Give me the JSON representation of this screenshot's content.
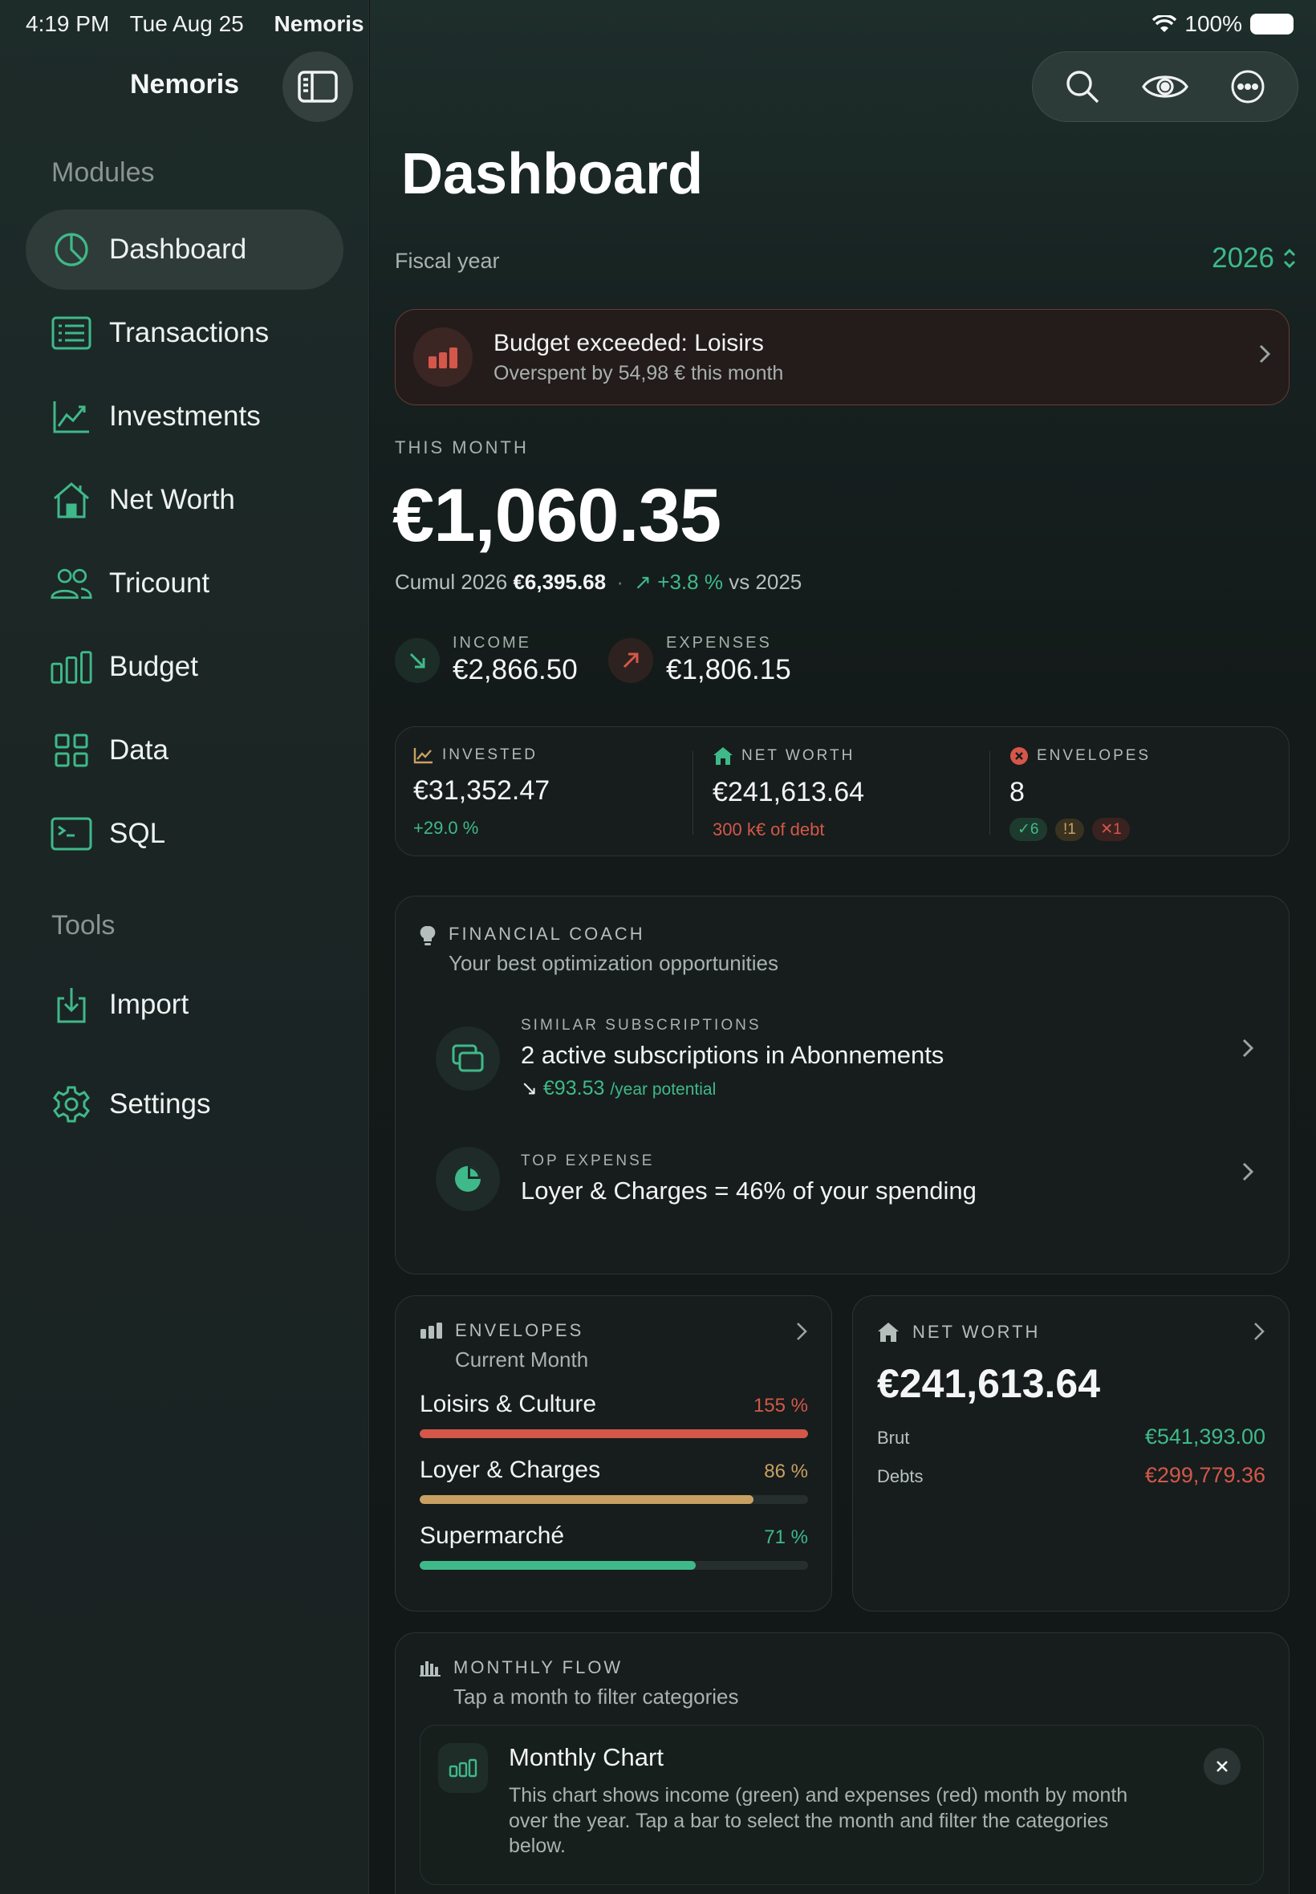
{
  "status_bar": {
    "time": "4:19 PM",
    "date": "Tue Aug 25",
    "app": "Nemoris",
    "battery": "100%"
  },
  "sidebar": {
    "title": "Nemoris",
    "modules_label": "Modules",
    "tools_label": "Tools",
    "items": [
      {
        "label": "Dashboard",
        "icon": "pie-chart-icon",
        "active": true
      },
      {
        "label": "Transactions",
        "icon": "list-icon"
      },
      {
        "label": "Investments",
        "icon": "trend-chart-icon"
      },
      {
        "label": "Net Worth",
        "icon": "house-icon"
      },
      {
        "label": "Tricount",
        "icon": "people-icon"
      },
      {
        "label": "Budget",
        "icon": "bar-chart-icon"
      },
      {
        "label": "Data",
        "icon": "grid-icon"
      },
      {
        "label": "SQL",
        "icon": "terminal-icon"
      }
    ],
    "tools": [
      {
        "label": "Import",
        "icon": "import-icon"
      },
      {
        "label": "Settings",
        "icon": "gear-icon"
      }
    ]
  },
  "main": {
    "title": "Dashboard",
    "fiscal_year_label": "Fiscal year",
    "fiscal_year_value": "2026",
    "alert": {
      "title": "Budget exceeded: Loisirs",
      "subtitle": "Overspent by 54,98 € this month"
    },
    "this_month": {
      "label": "THIS MONTH",
      "amount": "€1,060.35",
      "cumul_label": "Cumul 2026",
      "cumul_value": "€6,395.68",
      "cumul_change": "+3.8 %",
      "cumul_vs": "vs 2025"
    },
    "income": {
      "label": "INCOME",
      "value": "€2,866.50"
    },
    "expenses": {
      "label": "EXPENSES",
      "value": "€1,806.15"
    },
    "stats": {
      "invested": {
        "label": "INVESTED",
        "value": "€31,352.47",
        "sub": "+29.0 %"
      },
      "net_worth": {
        "label": "NET WORTH",
        "value": "€241,613.64",
        "sub": "300 k€ of debt"
      },
      "envelopes": {
        "label": "ENVELOPES",
        "value": "8",
        "ok": "✓6",
        "warn": "!1",
        "over": "✕1"
      }
    },
    "coach": {
      "title": "FINANCIAL COACH",
      "subtitle": "Your best optimization opportunities",
      "items": [
        {
          "tag": "SIMILAR SUBSCRIPTIONS",
          "text": "2 active subscriptions in Abonnements",
          "potential": "€93.53",
          "potential_suffix": "/year potential"
        },
        {
          "tag": "TOP EXPENSE",
          "text": "Loyer & Charges = 46% of your spending"
        }
      ]
    },
    "envelopes_card": {
      "title": "ENVELOPES",
      "subtitle": "Current Month",
      "rows": [
        {
          "name": "Loisirs & Culture",
          "pct": "155 %",
          "fill": 1.0,
          "color": "#d4574a"
        },
        {
          "name": "Loyer & Charges",
          "pct": "86 %",
          "fill": 0.86,
          "color": "#c9a063"
        },
        {
          "name": "Supermarché",
          "pct": "71 %",
          "fill": 0.71,
          "color": "#3fb98a"
        }
      ]
    },
    "net_worth_card": {
      "title": "NET WORTH",
      "value": "€241,613.64",
      "brut_label": "Brut",
      "brut_value": "€541,393.00",
      "debts_label": "Debts",
      "debts_value": "€299,779.36"
    },
    "monthly_flow": {
      "title": "MONTHLY FLOW",
      "subtitle": "Tap a month to filter categories",
      "tip_title": "Monthly Chart",
      "tip_body": "This chart shows income (green) and expenses (red) month by month over the year. Tap a bar to select the month and filter the categories below."
    }
  },
  "colors": {
    "accent": "#3fb98a",
    "danger": "#d4574a",
    "warning": "#c9a063"
  }
}
